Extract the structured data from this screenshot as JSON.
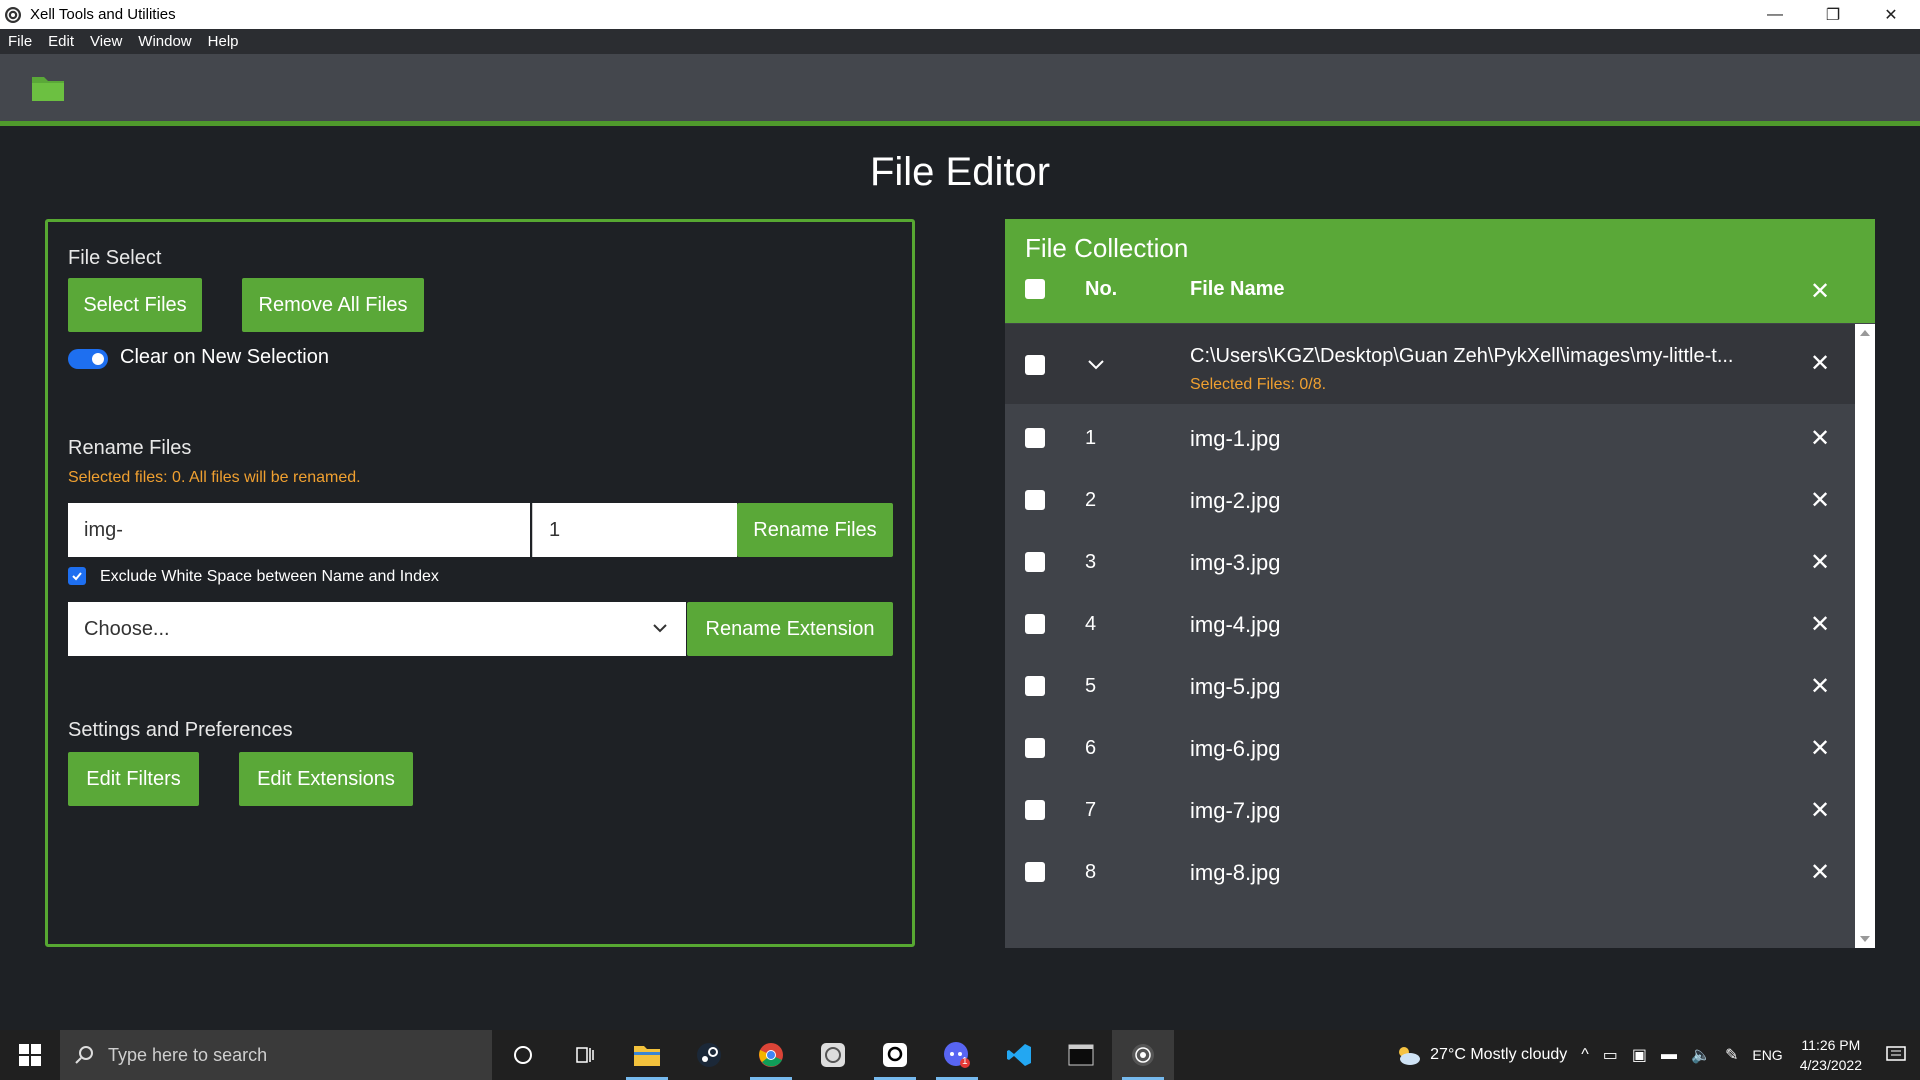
{
  "window": {
    "title": "Xell Tools and Utilities",
    "minimize": "—",
    "restore": "❐",
    "close": "✕"
  },
  "menu": [
    "File",
    "Edit",
    "View",
    "Window",
    "Help"
  ],
  "page": {
    "title": "File Editor"
  },
  "left": {
    "file_select_label": "File Select",
    "select_files_btn": "Select Files",
    "remove_all_btn": "Remove All Files",
    "toggle_label": "Clear on New Selection",
    "toggle_on": true,
    "rename_label": "Rename Files",
    "rename_warning": "Selected files: 0. All files will be renamed.",
    "name_value": "img-",
    "index_value": "1",
    "rename_btn": "Rename Files",
    "exclude_ws_label": "Exclude White Space between Name and Index",
    "exclude_ws_checked": true,
    "ext_placeholder": "Choose...",
    "rename_ext_btn": "Rename Extension",
    "settings_label": "Settings and Preferences",
    "edit_filters_btn": "Edit Filters",
    "edit_ext_btn": "Edit Extensions"
  },
  "collection": {
    "title": "File Collection",
    "col_no": "No.",
    "col_name": "File Name",
    "group": {
      "path": "C:\\Users\\KGZ\\Desktop\\Guan Zeh\\PykXell\\images\\my-little-t...",
      "selected": "Selected Files: 0/8."
    },
    "files": [
      {
        "no": "1",
        "name": "img-1.jpg"
      },
      {
        "no": "2",
        "name": "img-2.jpg"
      },
      {
        "no": "3",
        "name": "img-3.jpg"
      },
      {
        "no": "4",
        "name": "img-4.jpg"
      },
      {
        "no": "5",
        "name": "img-5.jpg"
      },
      {
        "no": "6",
        "name": "img-6.jpg"
      },
      {
        "no": "7",
        "name": "img-7.jpg"
      },
      {
        "no": "8",
        "name": "img-8.jpg"
      }
    ]
  },
  "taskbar": {
    "search_placeholder": "Type here to search",
    "weather": "27°C  Mostly cloudy",
    "lang": "ENG",
    "time": "11:26 PM",
    "date": "4/23/2022",
    "chat_badge": "1"
  },
  "colors": {
    "accent_green": "#5aa838",
    "background": "#1e2125",
    "warning_orange": "#f0a030",
    "toggle_blue": "#1e6ff0"
  }
}
